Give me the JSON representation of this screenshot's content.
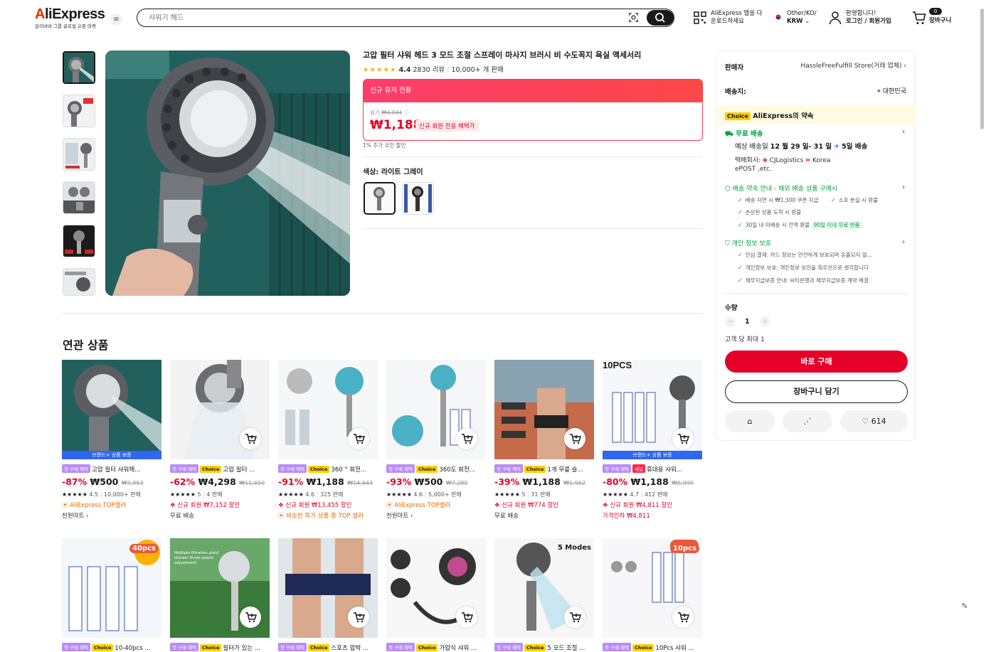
{
  "header": {
    "logo": "AliExpress",
    "logo_sub": "알리바바 그룹 글로벌 오픈 마켓",
    "search_placeholder": "샤워기 헤드",
    "app_line1": "AliExpress 앱을 다",
    "app_line2": "운로드하세요",
    "locale_line1": "Other/KO/",
    "locale_line2": "KRW",
    "account_line1": "환영합니다!",
    "account_line2": "로그인 / 회원가입",
    "cart_count": "0",
    "cart_label": "장바구니"
  },
  "product": {
    "title": "고압 필터 샤워 헤드 3 모드 조절 스프레이 마사지 브러시 비 수도꼭지 욕실 액세서리",
    "rating": "4.4",
    "reviews": "2830 리뷰",
    "sold": "10,000+ 개 판매",
    "new_user_banner": "신규 유저 전용",
    "orig_label": "원가",
    "orig_price": "₩4,844",
    "price": "₩1,188",
    "price_pill": "신규 회원 전용 혜택가",
    "coin_note": "1% 추가 코인 할인",
    "color_label": "색상: 라이트 그레이"
  },
  "seller_panel": {
    "seller_label": "판매자",
    "seller_name": "HassleFreeFulfill Store(거래 업체)",
    "ship_to_label": "배송지:",
    "ship_to": "대한민국",
    "choice_badge": "Choice",
    "promise": "AliExpress의 약속",
    "free_ship": "무료 배송",
    "eta_prefix": "예상 배송일",
    "eta_dates": "12 월 29 일- 31 일",
    "eta_days": "5일 배송",
    "carrier_label": "택배회사:",
    "carrier": "CJLogistics",
    "carrier2": "Korea",
    "carrier3": "ePOST ,etc.",
    "delivery_promise": "배송 약속 안내 - 해외 배송 상품 구매시",
    "dp1": "배송 지연 시 ₩1,300 쿠폰 지급",
    "dp2": "소포 분실 시 환불",
    "dp3": "손상된 상품 도착 시 환불",
    "dp4": "30일 내 미배송 시 전액 환불",
    "dp4_badge": "90일 이내 무료 반품",
    "privacy": "개인 정보 보호",
    "pv1": "안심 결제: 카드 정보는 안전하게 보호되며 유출되지 않...",
    "pv2": "개인정보 보호: 개인정보 보안을 최우선으로 생각합니다",
    "pv3": "채무지급보증 안내: 씨티은행과 채무지급보증 계약 체결",
    "qty_label": "수량",
    "qty": "1",
    "max_note": "고객 당 최대 1",
    "buy_now": "바로 구매",
    "add_cart": "장바구니 담기",
    "wish_count": "614"
  },
  "related": {
    "title": "연관 상품",
    "brand_bar": "브랜드+ 상품 보증",
    "first_tag": "첫 구매 혜택",
    "choice_tag": "Choice",
    "sale_tag": "세일",
    "items": [
      {
        "title": "고압 필터 샤워헤...",
        "disc": "-87%",
        "price": "₩500",
        "orig": "₩3,853",
        "rating": "4.5",
        "sold": "10,000+ 판매",
        "line1": "AliExpress TOP셀러",
        "line2": "천원마트 ›"
      },
      {
        "title": "고압 필터 ...",
        "disc": "-62%",
        "price": "₩4,298",
        "orig": "₩11,450",
        "rating": "5",
        "sold": "4 판매",
        "line1": "신규 회원 ₩7,152 할인",
        "line2": "무료 배송"
      },
      {
        "title": "360 ° 회전...",
        "disc": "-91%",
        "price": "₩1,188",
        "orig": "₩14,643",
        "rating": "4.6",
        "sold": "325 판매",
        "line1": "신규 회원 ₩13,455 할인",
        "line2": "비슷한 특가 상품 중 TOP 셀러"
      },
      {
        "title": "360도 회전...",
        "disc": "-93%",
        "price": "₩500",
        "orig": "₩7,280",
        "rating": "4.6",
        "sold": "5,000+ 판매",
        "line1": "AliExpress TOP셀러",
        "line2": "천원마트 ›"
      },
      {
        "title": "1개 무릎 슬...",
        "disc": "-39%",
        "price": "₩1,188",
        "orig": "₩1,962",
        "rating": "5",
        "sold": "31 판매",
        "line1": "신규 회원 ₩774 할인",
        "line2": "무료 배송"
      },
      {
        "title": "휴대용 샤워...",
        "disc": "-80%",
        "price": "₩1,188",
        "orig": "₩5,999",
        "rating": "4.7",
        "sold": "412 판매",
        "line1": "신규 회원 ₩4,811 할인",
        "line2": "가격인하 ₩4,811"
      }
    ],
    "row2": [
      {
        "title": "10-40pcs ...",
        "badge": "40pcs"
      },
      {
        "title": "필터가 있는 ...",
        "badge": ""
      },
      {
        "title": "스포츠 압박 ...",
        "badge": ""
      },
      {
        "title": "가압식 샤워 ...",
        "badge": ""
      },
      {
        "title": "5 모드 조절 ...",
        "badge": "5 Modes"
      },
      {
        "title": "10Pcs 샤워 ...",
        "badge": "10pcs"
      }
    ],
    "img_text_1": "10PCS",
    "img_text_2": "Multiple filtration plaid shower three-speed adjustment",
    "brand_bar_2": "브랜드+ 상품 보증"
  },
  "colors": {
    "accent": "#e50027",
    "brand": "#e62e04",
    "green": "#00a33e",
    "choice": "#fed100"
  }
}
